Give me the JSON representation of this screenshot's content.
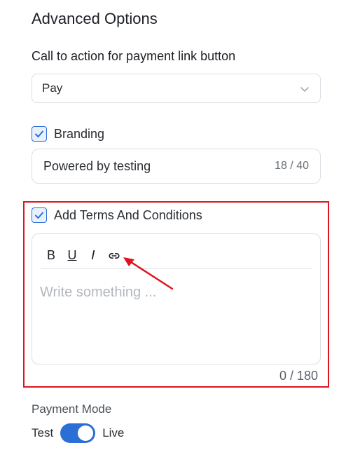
{
  "section": {
    "title": "Advanced Options"
  },
  "cta": {
    "label": "Call to action for payment link button",
    "selected": "Pay"
  },
  "branding": {
    "label": "Branding",
    "checked": true,
    "value": "Powered by testing",
    "counter": "18 / 40"
  },
  "terms": {
    "label": "Add Terms And Conditions",
    "checked": true,
    "toolbar": {
      "bold": "B",
      "underline": "U",
      "italic": "I"
    },
    "placeholder": "Write something ...",
    "counter": "0 / 180"
  },
  "payment_mode": {
    "label": "Payment Mode",
    "left": "Test",
    "right": "Live",
    "live_enabled": true
  },
  "colors": {
    "accent": "#2b6fd6",
    "highlight": "#e0141e"
  }
}
